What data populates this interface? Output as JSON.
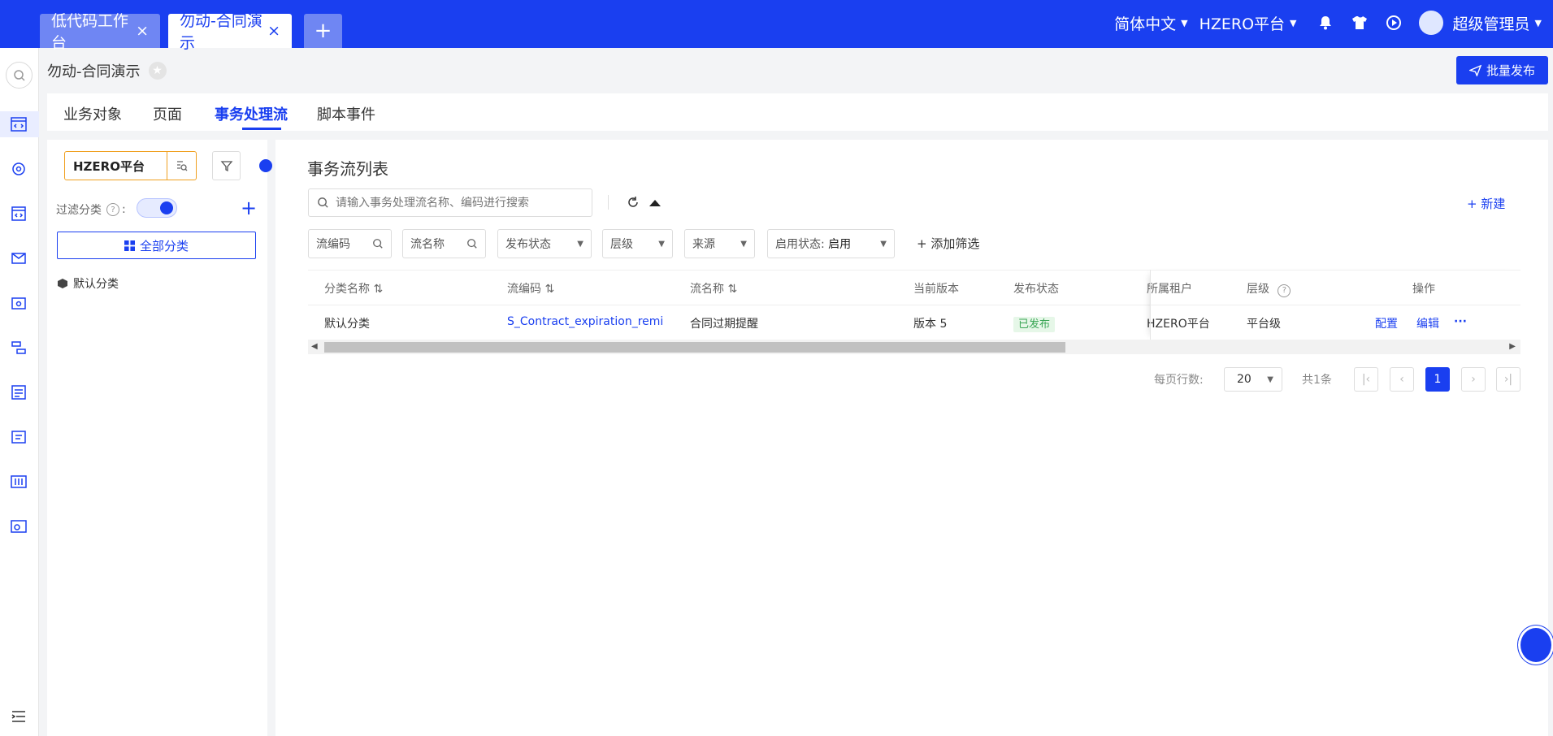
{
  "topbar": {
    "tabs": [
      {
        "label": "低代码工作台",
        "close": "×"
      },
      {
        "label": "勿动-合同演示",
        "close": "×"
      }
    ],
    "add_tab": "+",
    "language": "简体中文",
    "tenant": "HZERO平台",
    "user": "超级管理员"
  },
  "header": {
    "breadcrumb": "勿动-合同演示",
    "batch_publish": "批量发布"
  },
  "tabs": [
    "业务对象",
    "页面",
    "事务处理流",
    "脚本事件"
  ],
  "left_panel": {
    "tenant_value": "HZERO平台",
    "filter_category_label": "过滤分类",
    "all_categories_button": "全部分类",
    "tree_items": [
      "默认分类"
    ]
  },
  "main": {
    "title": "事务流列表",
    "search_placeholder": "请输入事务处理流名称、编码进行搜索",
    "new_button": "新建",
    "filters": {
      "flow_code": "流编码",
      "flow_name": "流名称",
      "publish_status": "发布状态",
      "level": "层级",
      "source": "来源",
      "enable_status_label": "启用状态:",
      "enable_status_value": "启用",
      "add_filter": "添加筛选"
    },
    "table": {
      "columns": [
        "分类名称",
        "流编码",
        "流名称",
        "当前版本",
        "发布状态",
        "所属租户",
        "层级",
        "操作"
      ],
      "rows": [
        {
          "category": "默认分类",
          "code": "S_Contract_expiration_remi",
          "name": "合同过期提醒",
          "version": "版本 5",
          "status": "已发布",
          "tenant": "HZERO平台",
          "level": "平台级",
          "action_config": "配置",
          "action_edit": "编辑",
          "action_more": "···"
        }
      ]
    },
    "pagination": {
      "rows_per_page_label": "每页行数:",
      "rows_per_page": "20",
      "total": "共1条",
      "current_page": "1"
    }
  },
  "colors": {
    "primary": "#1a3ff0",
    "success_bg": "#e6f7e8",
    "success_text": "#3aa655"
  }
}
